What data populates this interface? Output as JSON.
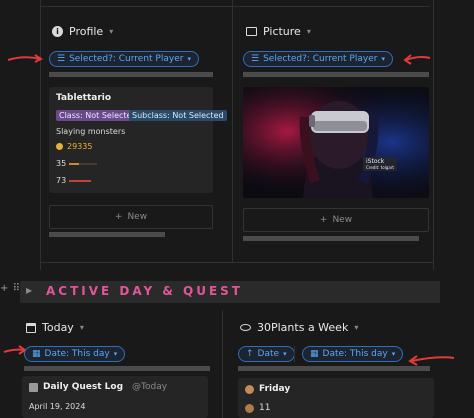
{
  "profile": {
    "title": "Profile",
    "filter_label": "Selected?: Current Player",
    "card": {
      "name": "Tablettario",
      "class_tag": "Class: Not Selected",
      "subclass_tag": "Subclass: Not Selected",
      "description": "Slaying monsters",
      "coins": "29335",
      "stat1": "35",
      "stat2": "73"
    },
    "new_label": "New"
  },
  "picture": {
    "title": "Picture",
    "filter_label": "Selected?: Current Player",
    "watermark_brand": "iStock",
    "watermark_credit": "Credit: tolgart",
    "new_label": "New"
  },
  "active_section": {
    "heading": "ACTIVE DAY & QUEST"
  },
  "today": {
    "title": "Today",
    "filter_label": "Date: This day",
    "card_title": "Daily Quest Log",
    "card_mention": "@Today",
    "card_date": "April 19, 2024"
  },
  "plants": {
    "title": "30Plants a Week",
    "sort_label": "Date",
    "filter_label": "Date: This day",
    "card_title": "Friday",
    "card_value": "11"
  },
  "colors": {
    "accent_pink": "#e0569a",
    "filter_blue": "#5ea6ee",
    "annotation_red": "#e23a3a"
  }
}
